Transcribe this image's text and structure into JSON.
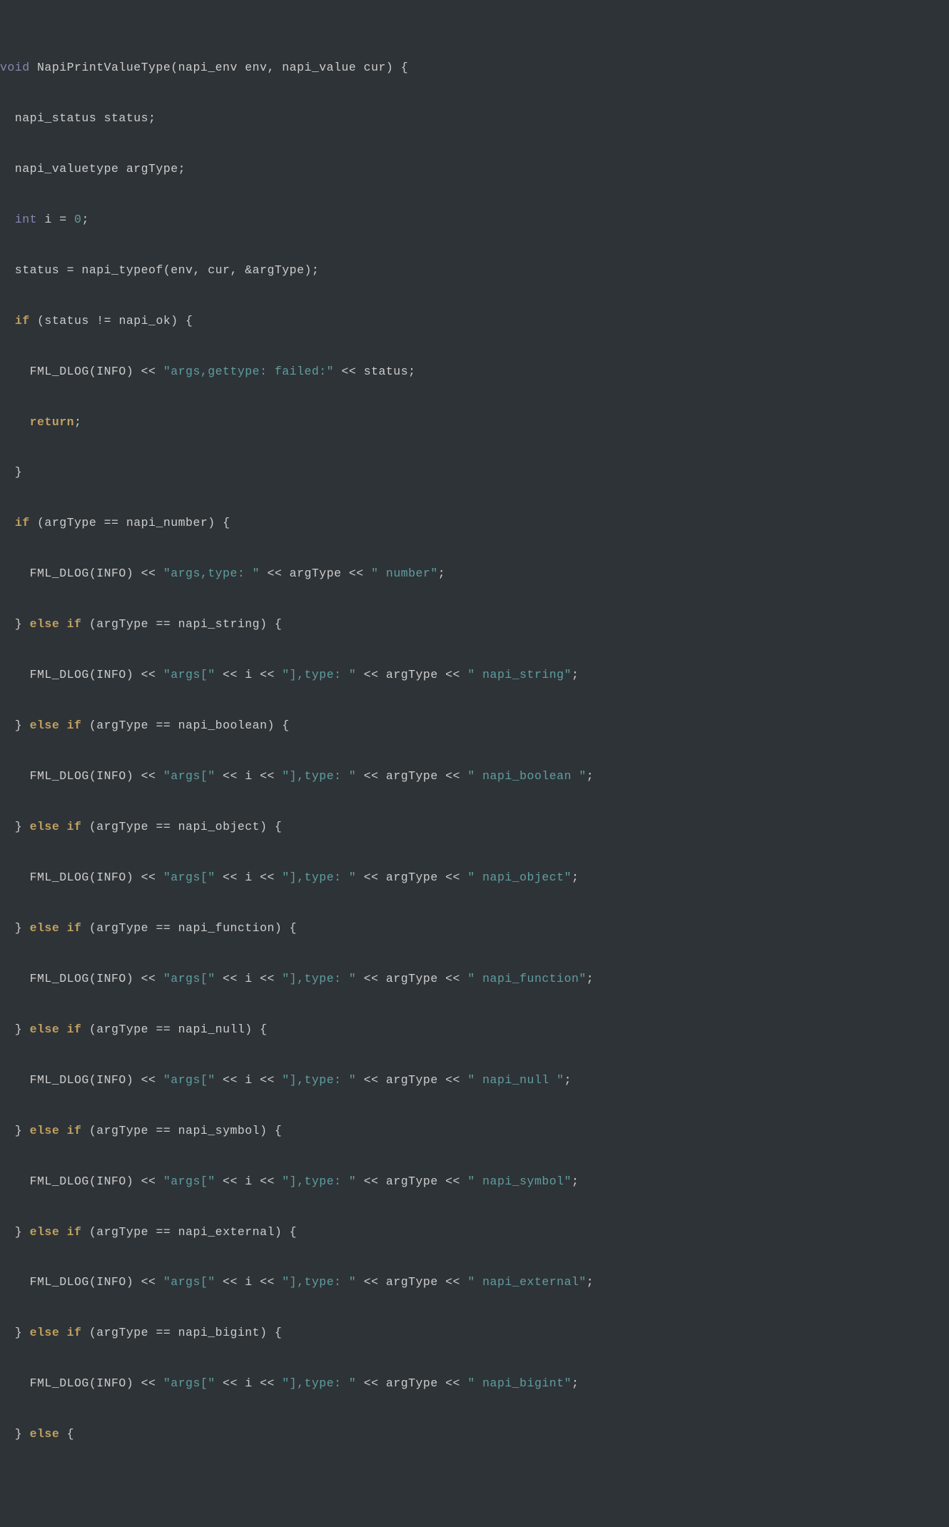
{
  "syntax": {
    "keywords_type": [
      "void",
      "int"
    ],
    "keywords_control": [
      "if",
      "else",
      "else if",
      "return"
    ],
    "strings": [
      "\"args,gettype: failed:\"",
      "\"args,type: \"",
      "\" number\"",
      "\"args[\"",
      "\"],type: \"",
      "\" napi_string\"",
      "\" napi_boolean \"",
      "\" napi_object\"",
      "\" napi_function\"",
      "\" napi_null \"",
      "\" napi_symbol\"",
      "\" napi_external\"",
      "\" napi_bigint\""
    ],
    "numbers": [
      "0"
    ]
  },
  "l0": {
    "kw": "void",
    "rest": " NapiPrintValueType(napi_env env, napi_value cur) {"
  },
  "l1": {
    "txt": "  napi_status status;"
  },
  "l2": {
    "txt": "  napi_valuetype argType;"
  },
  "l3": {
    "kw": "int",
    "mid": " i = ",
    "num": "0",
    "end": ";"
  },
  "l4": {
    "txt": "  status = napi_typeof(env, cur, &argType);"
  },
  "l5": {
    "kw": "if",
    "rest": " (status != napi_ok) {"
  },
  "l6": {
    "lead": "    FML_DLOG(INFO) << ",
    "str": "\"args,gettype: failed:\"",
    "tail": " << status;"
  },
  "l7": {
    "kw": "return",
    "end": ";"
  },
  "l8": {
    "txt": "  }"
  },
  "l9": {
    "kw": "if",
    "rest": " (argType == napi_number) {"
  },
  "l10": {
    "lead": "    FML_DLOG(INFO) << ",
    "str1": "\"args,type: \"",
    "mid": " << argType << ",
    "str2": "\" number\"",
    "end": ";"
  },
  "l11": {
    "c1": "  } ",
    "kw1": "else",
    "sp": " ",
    "kw2": "if",
    "rest": " (argType == napi_string) {"
  },
  "l12": {
    "lead": "    FML_DLOG(INFO) << ",
    "s1": "\"args[\"",
    "m1": " << i << ",
    "s2": "\"],type: \"",
    "m2": " << argType << ",
    "s3": "\" napi_string\"",
    "end": ";"
  },
  "l13": {
    "c1": "  } ",
    "kw1": "else",
    "sp": " ",
    "kw2": "if",
    "rest": " (argType == napi_boolean) {"
  },
  "l14": {
    "lead": "    FML_DLOG(INFO) << ",
    "s1": "\"args[\"",
    "m1": " << i << ",
    "s2": "\"],type: \"",
    "m2": " << argType << ",
    "s3": "\" napi_boolean \"",
    "end": ";"
  },
  "l15": {
    "c1": "  } ",
    "kw1": "else",
    "sp": " ",
    "kw2": "if",
    "rest": " (argType == napi_object) {"
  },
  "l16": {
    "lead": "    FML_DLOG(INFO) << ",
    "s1": "\"args[\"",
    "m1": " << i << ",
    "s2": "\"],type: \"",
    "m2": " << argType << ",
    "s3": "\" napi_object\"",
    "end": ";"
  },
  "l17": {
    "c1": "  } ",
    "kw1": "else",
    "sp": " ",
    "kw2": "if",
    "rest": " (argType == napi_function) {"
  },
  "l18": {
    "lead": "    FML_DLOG(INFO) << ",
    "s1": "\"args[\"",
    "m1": " << i << ",
    "s2": "\"],type: \"",
    "m2": " << argType << ",
    "s3": "\" napi_function\"",
    "end": ";"
  },
  "l19": {
    "c1": "  } ",
    "kw1": "else",
    "sp": " ",
    "kw2": "if",
    "rest": " (argType == napi_null) {"
  },
  "l20": {
    "lead": "    FML_DLOG(INFO) << ",
    "s1": "\"args[\"",
    "m1": " << i << ",
    "s2": "\"],type: \"",
    "m2": " << argType << ",
    "s3": "\" napi_null \"",
    "end": ";"
  },
  "l21": {
    "c1": "  } ",
    "kw1": "else",
    "sp": " ",
    "kw2": "if",
    "rest": " (argType == napi_symbol) {"
  },
  "l22": {
    "lead": "    FML_DLOG(INFO) << ",
    "s1": "\"args[\"",
    "m1": " << i << ",
    "s2": "\"],type: \"",
    "m2": " << argType << ",
    "s3": "\" napi_symbol\"",
    "end": ";"
  },
  "l23": {
    "c1": "  } ",
    "kw1": "else",
    "sp": " ",
    "kw2": "if",
    "rest": " (argType == napi_external) {"
  },
  "l24": {
    "lead": "    FML_DLOG(INFO) << ",
    "s1": "\"args[\"",
    "m1": " << i << ",
    "s2": "\"],type: \"",
    "m2": " << argType << ",
    "s3": "\" napi_external\"",
    "end": ";"
  },
  "l25": {
    "c1": "  } ",
    "kw1": "else",
    "sp": " ",
    "kw2": "if",
    "rest": " (argType == napi_bigint) {"
  },
  "l26": {
    "lead": "    FML_DLOG(INFO) << ",
    "s1": "\"args[\"",
    "m1": " << i << ",
    "s2": "\"],type: \"",
    "m2": " << argType << ",
    "s3": "\" napi_bigint\"",
    "end": ";"
  },
  "l27": {
    "c1": "  } ",
    "kw1": "else",
    "rest": " {"
  }
}
